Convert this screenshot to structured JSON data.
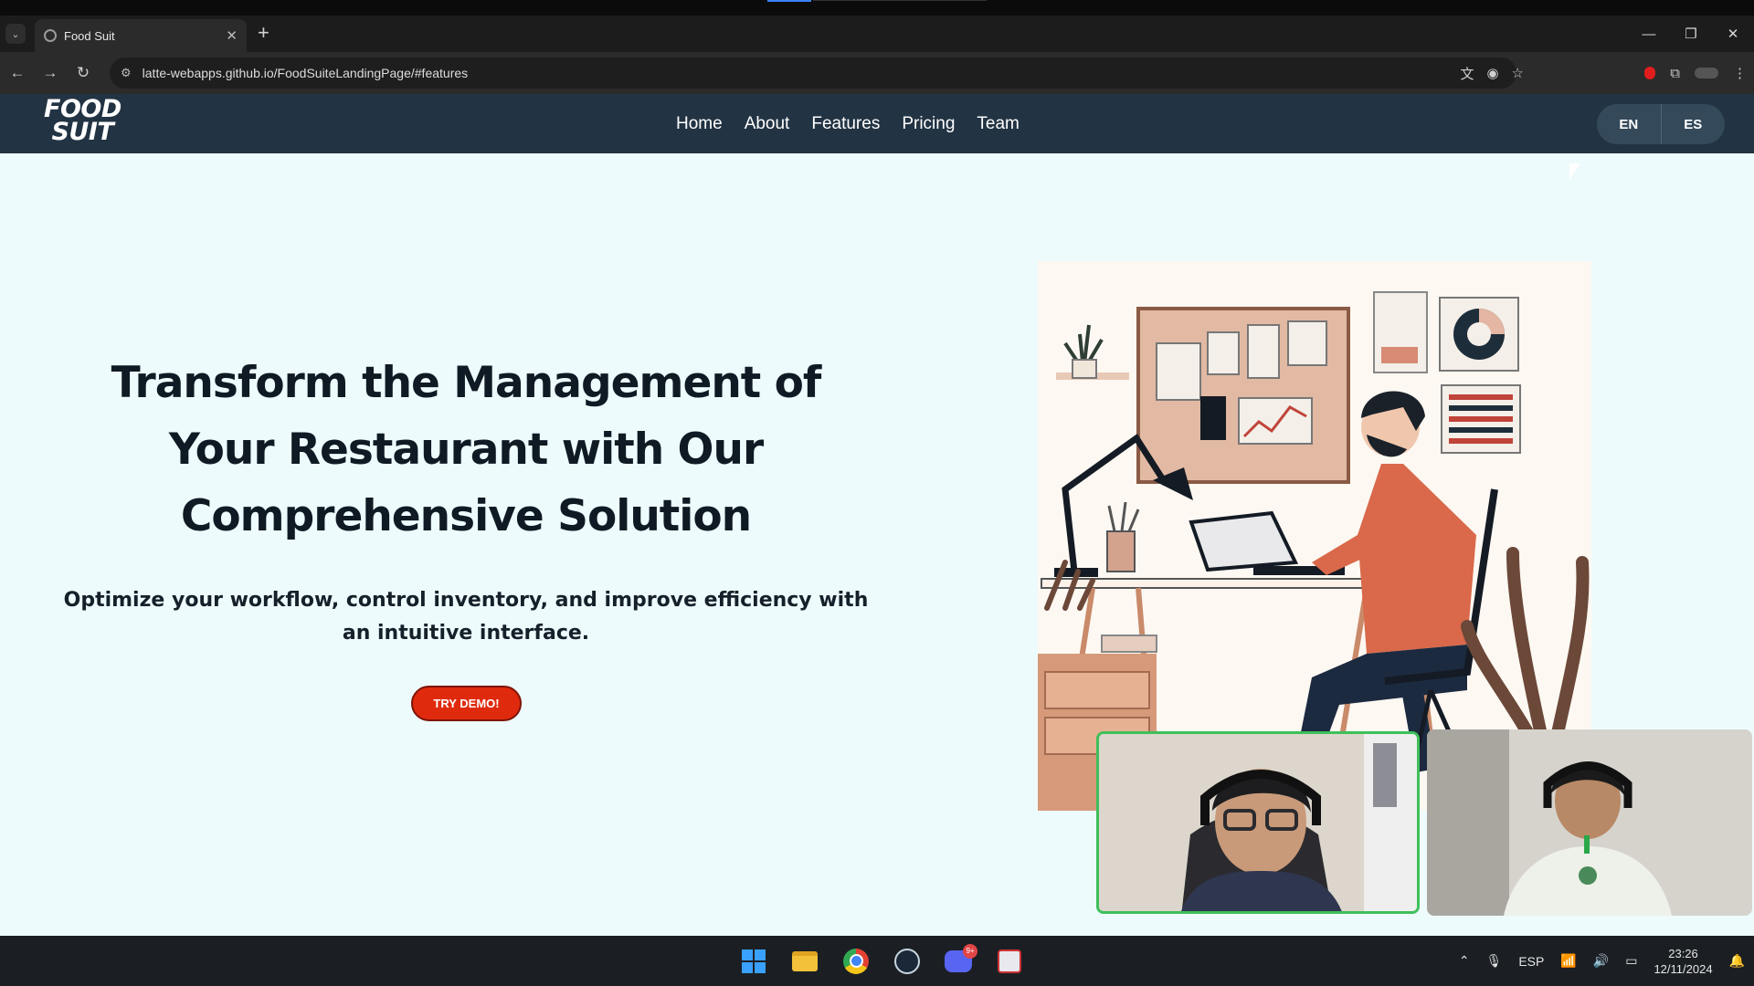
{
  "browser": {
    "tab_title": "Food Suit",
    "url": "latte-webapps.github.io/FoodSuiteLandingPage/#features",
    "icons": {
      "tab_menu": "chevron-down-icon",
      "tab_favicon": "globe-icon",
      "tab_close": "close-icon",
      "new_tab": "plus-icon",
      "back": "back-icon",
      "forward": "forward-icon",
      "reload": "reload-icon",
      "site_info": "tune-icon",
      "translate": "translate-icon",
      "tracking": "eye-off-icon",
      "bookmark": "star-icon",
      "extensions": "puzzle-icon",
      "menu": "more-vertical-icon"
    }
  },
  "site": {
    "logo_line1": "FOOD",
    "logo_line2": "SUIT",
    "nav": [
      "Home",
      "About",
      "Features",
      "Pricing",
      "Team"
    ],
    "lang": [
      "EN",
      "ES"
    ],
    "hero_title": "Transform the Management of Your Restaurant with Our Comprehensive Solution",
    "hero_subtitle": "Optimize your workflow, control inventory, and improve efficiency with an intuitive interface.",
    "cta": "TRY DEMO!",
    "colors": {
      "navbar": "#223343",
      "background": "#eefbfd",
      "cta": "#e02a0e",
      "heading": "#0f1a24"
    }
  },
  "taskbar": {
    "apps": [
      "windows-start-icon",
      "file-explorer-icon",
      "chrome-icon",
      "steam-icon",
      "discord-icon",
      "snipping-tool-icon"
    ],
    "discord_badge": "9+",
    "input_language": "ESP",
    "time": "23:26",
    "date": "12/11/2024"
  }
}
